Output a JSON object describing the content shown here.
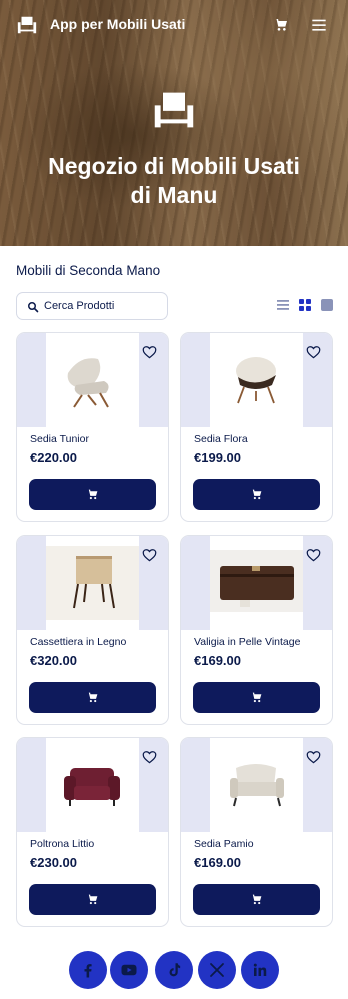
{
  "header": {
    "app_title": "App per Mobili Usati",
    "logo_icon": "armchair-icon",
    "cart_icon": "cart-icon",
    "menu_icon": "hamburger-menu-icon"
  },
  "hero": {
    "title": "Negozio di Mobili Usati di Manu",
    "icon": "armchair-icon"
  },
  "catalog": {
    "section_title": "Mobili di Seconda Mano",
    "search": {
      "placeholder": "Cerca Prodotti",
      "value": ""
    },
    "view_modes": [
      "list-view-icon",
      "grid-view-icon",
      "single-view-icon"
    ],
    "products": [
      {
        "name": "Sedia Tunior",
        "price": "€220.00"
      },
      {
        "name": "Sedia Flora",
        "price": "€199.00"
      },
      {
        "name": "Cassettiera in Legno",
        "price": "€320.00"
      },
      {
        "name": "Valigia in Pelle Vintage",
        "price": "€169.00"
      },
      {
        "name": "Poltrona Littio",
        "price": "€230.00"
      },
      {
        "name": "Sedia Pamio",
        "price": "€169.00"
      }
    ]
  },
  "footer": {
    "socials": [
      "facebook-icon",
      "youtube-icon",
      "tiktok-icon",
      "x-icon",
      "linkedin-icon"
    ]
  },
  "colors": {
    "primary_navy": "#0e1a5c",
    "social_blue": "#2233c4",
    "image_tint": "#e3e5f4"
  }
}
